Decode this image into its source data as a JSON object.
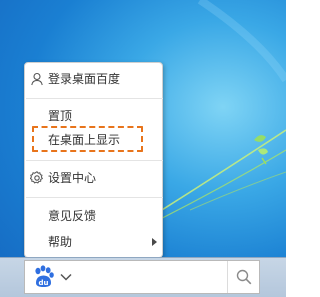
{
  "menu": {
    "items": [
      {
        "label": "登录桌面百度",
        "icon": "user-icon"
      },
      {
        "label": "置顶"
      },
      {
        "label": "在桌面上显示"
      },
      {
        "label": "设置中心",
        "icon": "gear-icon"
      },
      {
        "label": "意见反馈"
      },
      {
        "label": "帮助",
        "submenu_icon": "chevron-right-icon"
      }
    ],
    "highlight_color": "#e8741b"
  },
  "taskbar": {
    "search_logo": "baidu-paw-icon",
    "search_logo_text": "du",
    "dropdown_icon": "chevron-down-icon",
    "search_icon": "search-icon",
    "brand_color": "#2f6fe0"
  },
  "desktop": {
    "background_color": "#1a7fd2"
  }
}
